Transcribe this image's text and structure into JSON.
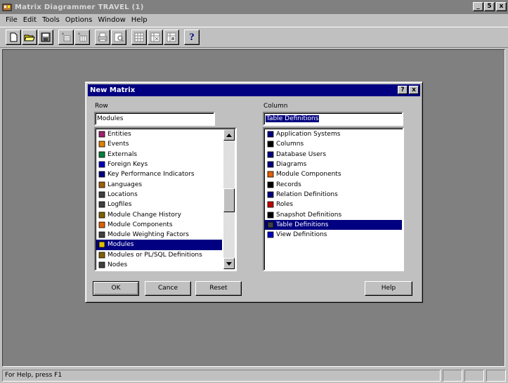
{
  "window": {
    "title": "Matrix Diagrammer TRAVEL (1)",
    "minimize": "_",
    "restore": "5",
    "close": "x"
  },
  "menu": [
    "File",
    "Edit",
    "Tools",
    "Options",
    "Window",
    "Help"
  ],
  "toolbar": {
    "buttons": [
      "new-icon",
      "open-icon",
      "save-icon",
      "add-row-icon",
      "add-column-icon",
      "print-icon",
      "print-preview-icon",
      "matrix-view-1-icon",
      "matrix-view-2-icon",
      "matrix-view-3-icon",
      "help-icon"
    ],
    "help_glyph": "?"
  },
  "status": {
    "text": "For Help, press F1"
  },
  "dialog": {
    "title": "New Matrix",
    "help_glyph": "?",
    "close_glyph": "x",
    "row_label": "Row",
    "row_value": "Modules",
    "column_label": "Column",
    "column_value": "Table Definitions",
    "row_items": [
      {
        "label": "Entities",
        "icon": "entities-icon",
        "color": "#a0206e"
      },
      {
        "label": "Events",
        "icon": "events-icon",
        "color": "#e08000"
      },
      {
        "label": "Externals",
        "icon": "externals-icon",
        "color": "#008040"
      },
      {
        "label": "Foreign Keys",
        "icon": "foreign-keys-icon",
        "color": "#0000c0"
      },
      {
        "label": "Key Performance Indicators",
        "icon": "kpi-icon",
        "color": "#000080"
      },
      {
        "label": "Languages",
        "icon": "languages-icon",
        "color": "#a06000"
      },
      {
        "label": "Locations",
        "icon": "locations-icon",
        "color": "#404040"
      },
      {
        "label": "Logfiles",
        "icon": "logfiles-icon",
        "color": "#404040"
      },
      {
        "label": "Module Change History",
        "icon": "module-history-icon",
        "color": "#806000"
      },
      {
        "label": "Module Components",
        "icon": "module-components-icon",
        "color": "#e06000"
      },
      {
        "label": "Module Weighting Factors",
        "icon": "module-weighting-icon",
        "color": "#404040"
      },
      {
        "label": "Modules",
        "icon": "modules-icon",
        "color": "#e0c000"
      },
      {
        "label": "Modules or PL/SQL Definitions",
        "icon": "plsql-icon",
        "color": "#806000"
      },
      {
        "label": "Nodes",
        "icon": "nodes-icon",
        "color": "#404040"
      }
    ],
    "row_selected": "Modules",
    "column_items": [
      {
        "label": "Application Systems",
        "icon": "application-systems-icon",
        "color": "#000080"
      },
      {
        "label": "Columns",
        "icon": "columns-icon",
        "color": "#000000"
      },
      {
        "label": "Database Users",
        "icon": "database-users-icon",
        "color": "#000080"
      },
      {
        "label": "Diagrams",
        "icon": "diagrams-icon",
        "color": "#000080"
      },
      {
        "label": "Module Components",
        "icon": "module-components-icon",
        "color": "#e06000"
      },
      {
        "label": "Records",
        "icon": "records-icon",
        "color": "#000000"
      },
      {
        "label": "Relation Definitions",
        "icon": "relation-definitions-icon",
        "color": "#000080"
      },
      {
        "label": "Roles",
        "icon": "roles-icon",
        "color": "#c00000"
      },
      {
        "label": "Snapshot Definitions",
        "icon": "snapshot-icon",
        "color": "#000000"
      },
      {
        "label": "Table Definitions",
        "icon": "table-definitions-icon",
        "color": "#404040"
      },
      {
        "label": "View Definitions",
        "icon": "view-definitions-icon",
        "color": "#0000c0"
      }
    ],
    "column_selected": "Table Definitions",
    "buttons": {
      "ok": "OK",
      "cancel": "Cance",
      "reset": "Reset",
      "help": "Help"
    }
  }
}
